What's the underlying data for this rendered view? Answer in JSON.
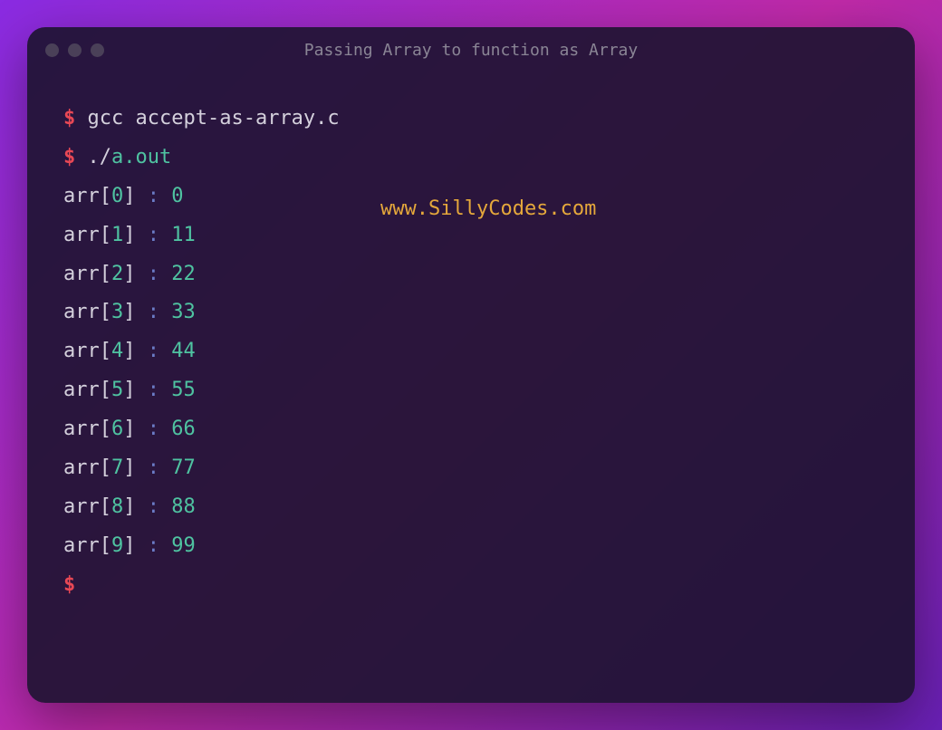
{
  "window": {
    "title": "Passing Array to function as Array"
  },
  "terminal": {
    "prompt": "$",
    "commands": [
      {
        "cmd": "gcc",
        "arg": "accept-as-array.c"
      },
      {
        "cmd": "./",
        "arg": "a.out"
      }
    ],
    "output": [
      {
        "index": "0",
        "value": "0"
      },
      {
        "index": "1",
        "value": "11"
      },
      {
        "index": "2",
        "value": "22"
      },
      {
        "index": "3",
        "value": "33"
      },
      {
        "index": "4",
        "value": "44"
      },
      {
        "index": "5",
        "value": "55"
      },
      {
        "index": "6",
        "value": "66"
      },
      {
        "index": "7",
        "value": "77"
      },
      {
        "index": "8",
        "value": "88"
      },
      {
        "index": "9",
        "value": "99"
      }
    ],
    "arr_label": "arr",
    "equals": ":"
  },
  "watermark": "www.SillyCodes.com"
}
